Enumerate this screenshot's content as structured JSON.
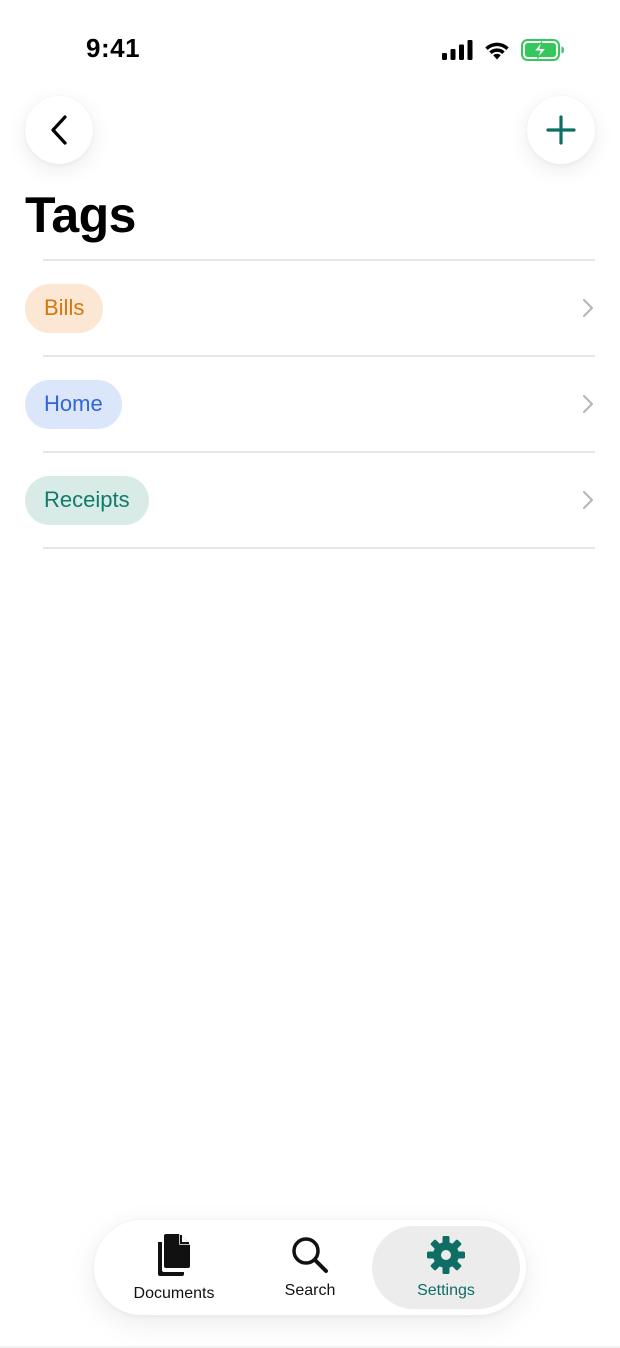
{
  "status_bar": {
    "time": "9:41"
  },
  "header": {
    "title": "Tags",
    "back_icon": "chevron-left-icon",
    "add_icon": "plus-icon",
    "accent_color": "#0e6e64"
  },
  "tags": [
    {
      "label": "Bills",
      "text_color": "#d4770f",
      "bg_color": "#fbe7d3"
    },
    {
      "label": "Home",
      "text_color": "#2f66d8",
      "bg_color": "#dbe6fb"
    },
    {
      "label": "Receipts",
      "text_color": "#127a6c",
      "bg_color": "#d8ebe6"
    }
  ],
  "tab_bar": {
    "items": [
      {
        "label": "Documents",
        "icon": "documents-icon",
        "selected": false
      },
      {
        "label": "Search",
        "icon": "search-icon",
        "selected": false
      },
      {
        "label": "Settings",
        "icon": "gear-icon",
        "selected": true
      }
    ],
    "selected_color": "#0e6e64"
  }
}
